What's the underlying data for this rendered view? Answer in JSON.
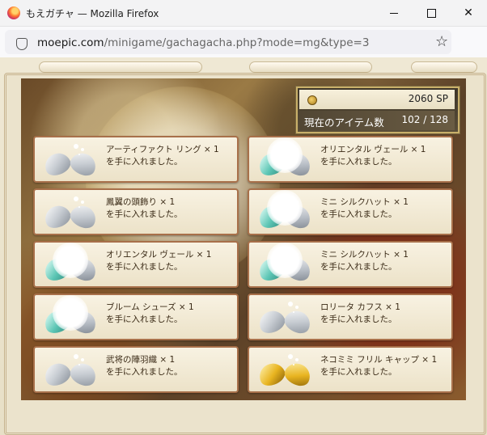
{
  "browser": {
    "window_title": "もえガチャ — Mozilla Firefox",
    "url_host": "moepic.com",
    "url_path": "/minigame/gachagacha.php?mode=mg&type=3"
  },
  "status": {
    "sp": "2060 SP",
    "stock_label": "現在のアイテム数",
    "stock_value": "102 / 128"
  },
  "results": [
    {
      "item": "アーティファクト リング × 1",
      "suffix": "を手に入れました。",
      "capsule": "silver",
      "orb": false
    },
    {
      "item": "オリエンタル ヴェール × 1",
      "suffix": "を手に入れました。",
      "capsule": "teal",
      "orb": true
    },
    {
      "item": "鳳翼の頭飾り × 1",
      "suffix": "を手に入れました。",
      "capsule": "silver",
      "orb": false
    },
    {
      "item": "ミニ シルクハット × 1",
      "suffix": "を手に入れました。",
      "capsule": "teal",
      "orb": true
    },
    {
      "item": "オリエンタル ヴェール × 1",
      "suffix": "を手に入れました。",
      "capsule": "teal",
      "orb": true
    },
    {
      "item": "ミニ シルクハット × 1",
      "suffix": "を手に入れました。",
      "capsule": "teal",
      "orb": true
    },
    {
      "item": "ブルーム シューズ × 1",
      "suffix": "を手に入れました。",
      "capsule": "teal",
      "orb": true
    },
    {
      "item": "ロリータ カフス × 1",
      "suffix": "を手に入れました。",
      "capsule": "silver",
      "orb": false
    },
    {
      "item": "武将の陣羽織 × 1",
      "suffix": "を手に入れました。",
      "capsule": "silver",
      "orb": false
    },
    {
      "item": "ネコミミ フリル キャップ × 1",
      "suffix": "を手に入れました。",
      "capsule": "gold",
      "orb": false
    }
  ]
}
